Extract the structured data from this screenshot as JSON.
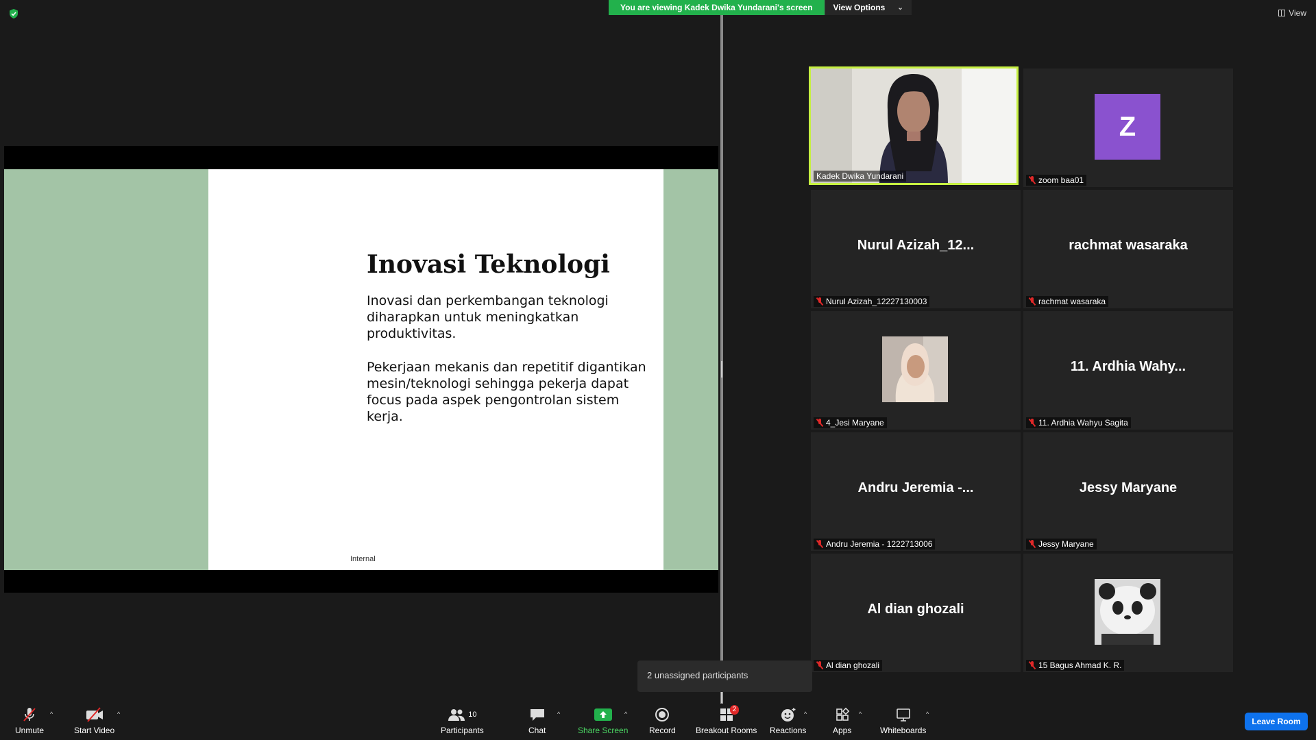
{
  "banner": {
    "viewing_text": "You are viewing Kadek Dwika Yundarani's screen",
    "view_options": "View Options",
    "view_button": "View"
  },
  "slide": {
    "title": "Inovasi Teknologi",
    "paragraph1": "Inovasi dan perkembangan teknologi diharapkan untuk meningkatkan produktivitas.",
    "paragraph2": "Pekerjaan mekanis dan repetitif digantikan mesin/teknologi sehingga pekerja dapat focus pada aspek pengontrolan sistem kerja.",
    "footer": "Internal"
  },
  "gallery": [
    {
      "tile_name": "",
      "label": "Kadek Dwika Yundarani",
      "muted": false,
      "avatar": "video",
      "active": true
    },
    {
      "tile_name": "",
      "label": "zoom baa01",
      "muted": true,
      "avatar": "letter",
      "avatar_letter": "Z",
      "avatar_color": "#8a52cf"
    },
    {
      "tile_name": "Nurul  Azizah_12...",
      "label": "Nurul Azizah_12227130003",
      "muted": true
    },
    {
      "tile_name": "rachmat wasaraka",
      "label": "rachmat wasaraka",
      "muted": true
    },
    {
      "tile_name": "",
      "label": "4_Jesi Maryane",
      "muted": true,
      "avatar": "photo-hijab"
    },
    {
      "tile_name": "11. Ardhia Wahy...",
      "label": "11. Ardhia Wahyu Sagita",
      "muted": true
    },
    {
      "tile_name": "Andru Jeremia -...",
      "label": "Andru Jeremia - 1222713006",
      "muted": true
    },
    {
      "tile_name": "Jessy Maryane",
      "label": "Jessy Maryane",
      "muted": true
    },
    {
      "tile_name": "Al dian ghozali",
      "label": "Al dian ghozali",
      "muted": true
    },
    {
      "tile_name": "",
      "label": "15 Bagus Ahmad K. R.",
      "muted": true,
      "avatar": "photo-panda"
    }
  ],
  "unassigned": "2 unassigned participants",
  "toolbar": {
    "unmute": "Unmute",
    "start_video": "Start Video",
    "participants": "Participants",
    "participants_count": "10",
    "chat": "Chat",
    "share_screen": "Share Screen",
    "record": "Record",
    "breakout_rooms": "Breakout Rooms",
    "breakout_badge": "2",
    "reactions": "Reactions",
    "apps": "Apps",
    "whiteboards": "Whiteboards",
    "leave_room": "Leave Room"
  },
  "colors": {
    "banner_green": "#22b14c",
    "active_border": "#c6f041",
    "leave_blue": "#0e72ed",
    "slide_green": "#a3c4a6"
  }
}
